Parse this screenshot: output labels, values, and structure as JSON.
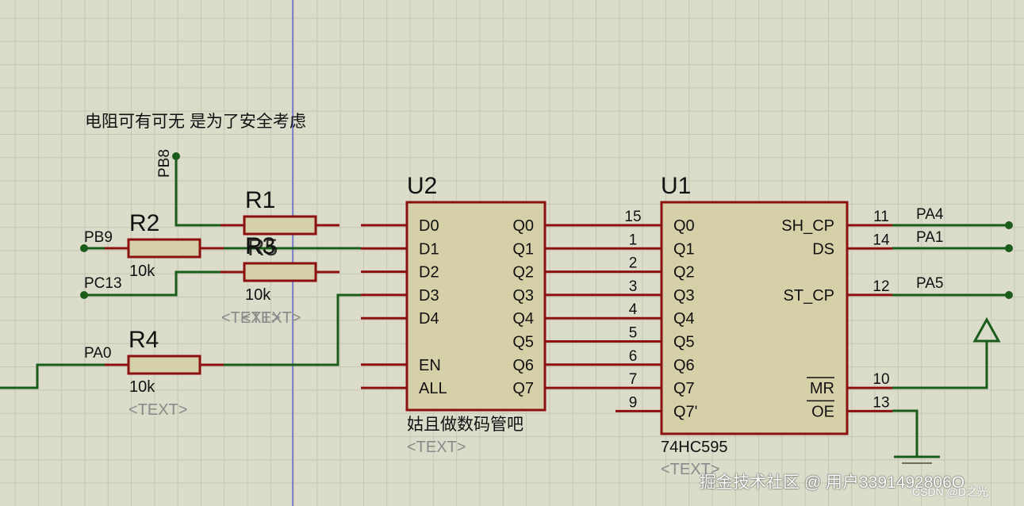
{
  "note": "电阻可有可无 是为了安全考虑",
  "net_labels": {
    "pb8": "PB8",
    "pb9": "PB9",
    "pc13": "PC13",
    "pa0": "PA0",
    "pa4": "PA4",
    "pa1": "PA1",
    "pa5": "PA5"
  },
  "resistors": {
    "r1": {
      "ref": "R1"
    },
    "r2": {
      "ref": "R2",
      "value": "10k"
    },
    "r3": {
      "ref": "R3",
      "ghost": "R5",
      "value": "10k",
      "text": "<TEXT>",
      "ghost_text": "<TEXT>"
    },
    "r4": {
      "ref": "R4",
      "value": "10k",
      "text": "<TEXT>"
    }
  },
  "u2": {
    "ref": "U2",
    "left_pins": [
      "D0",
      "D1",
      "D2",
      "D3",
      "D4",
      "",
      "EN",
      "ALL"
    ],
    "right_pins": [
      "Q0",
      "Q1",
      "Q2",
      "Q3",
      "Q4",
      "Q5",
      "Q6",
      "Q7"
    ],
    "caption": "姑且做数码管吧",
    "text": "<TEXT>"
  },
  "u1": {
    "ref": "U1",
    "part": "74HC595",
    "text": "<TEXT>",
    "left_pins": [
      "Q0",
      "Q1",
      "Q2",
      "Q3",
      "Q4",
      "Q5",
      "Q6",
      "Q7",
      "Q7'"
    ],
    "left_numbers": [
      "15",
      "1",
      "2",
      "3",
      "4",
      "5",
      "6",
      "7",
      "9"
    ],
    "right_pins": [
      {
        "name": "SH_CP",
        "number": "11",
        "clock": true,
        "overbar": false
      },
      {
        "name": "DS",
        "number": "14",
        "clock": false,
        "overbar": false
      },
      {
        "name": "ST_CP",
        "number": "12",
        "clock": true,
        "overbar": false
      },
      {
        "name": "MR",
        "number": "10",
        "clock": false,
        "overbar": true
      },
      {
        "name": "OE",
        "number": "13",
        "clock": false,
        "overbar": true
      }
    ]
  },
  "watermark": {
    "main": "掘金技术社区 @ 用户3391492806O",
    "sub": "CSDN @D之光"
  },
  "colors": {
    "background": "#dcdccb",
    "grid": "#c6c6b4",
    "wire": "#1a5c1a",
    "pin": "#8b1010",
    "body_fill": "#d6d0a8",
    "body_stroke": "#8b1010",
    "text": "#111111",
    "ghost_text": "#8a8a8a",
    "cursor_line": "#2a2ad8"
  }
}
